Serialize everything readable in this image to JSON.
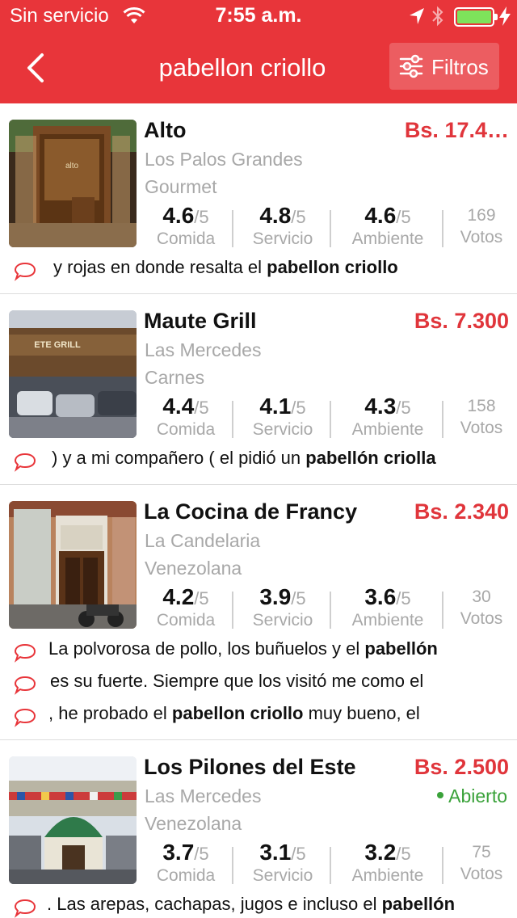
{
  "status": {
    "carrier": "Sin servicio",
    "time": "7:55 a.m.",
    "battery_color": "#7ee35b"
  },
  "nav": {
    "title": "pabellon criollo",
    "filters_label": "Filtros",
    "back_icon": "chevron-left-icon",
    "filters_icon": "sliders-icon"
  },
  "theme": {
    "accent": "#e8353a",
    "price": "#e0353b",
    "open": "#3aa23a",
    "muted": "#a8a8a8"
  },
  "restaurants": [
    {
      "name": "Alto",
      "price": "Bs. 17.4…",
      "neighborhood": "Los Palos Grandes",
      "cuisine": "Gourmet",
      "open": "",
      "food": "4.6",
      "service": "4.8",
      "ambience": "4.6",
      "denominator": "/5",
      "votes": "169",
      "reviews": [
        {
          "pre": "y rojas en donde resalta el ",
          "bold": "pabellon criollo",
          "post": ""
        }
      ]
    },
    {
      "name": "Maute Grill",
      "price": "Bs. 7.300",
      "neighborhood": "Las Mercedes",
      "cuisine": "Carnes",
      "open": "",
      "food": "4.4",
      "service": "4.1",
      "ambience": "4.3",
      "denominator": "/5",
      "votes": "158",
      "reviews": [
        {
          "pre": ") y a mi compañero ( el pidió un ",
          "bold": "pabellón criolla",
          "post": ""
        }
      ]
    },
    {
      "name": "La Cocina de Francy",
      "price": "Bs. 2.340",
      "neighborhood": "La Candelaria",
      "cuisine": "Venezolana",
      "open": "",
      "food": "4.2",
      "service": "3.9",
      "ambience": "3.6",
      "denominator": "/5",
      "votes": "30",
      "reviews": [
        {
          "pre": "La polvorosa de pollo, los buñuelos y el ",
          "bold": "pabellón",
          "post": ""
        },
        {
          "pre": " es su fuerte.  Siempre que los visitó me como el",
          "bold": "",
          "post": ""
        },
        {
          "pre": ", he probado el ",
          "bold": "pabellon criollo",
          "post": " muy bueno, el"
        }
      ]
    },
    {
      "name": "Los Pilones del Este",
      "price": "Bs. 2.500",
      "neighborhood": "Las Mercedes",
      "cuisine": "Venezolana",
      "open": "Abierto",
      "food": "3.7",
      "service": "3.1",
      "ambience": "3.2",
      "denominator": "/5",
      "votes": "75",
      "reviews": [
        {
          "pre": ". Las arepas, cachapas, jugos e incluso el ",
          "bold": "pabellón",
          "post": ""
        }
      ]
    }
  ],
  "labels": {
    "food": "Comida",
    "service": "Servicio",
    "ambience": "Ambiente",
    "votes": "Votos"
  }
}
